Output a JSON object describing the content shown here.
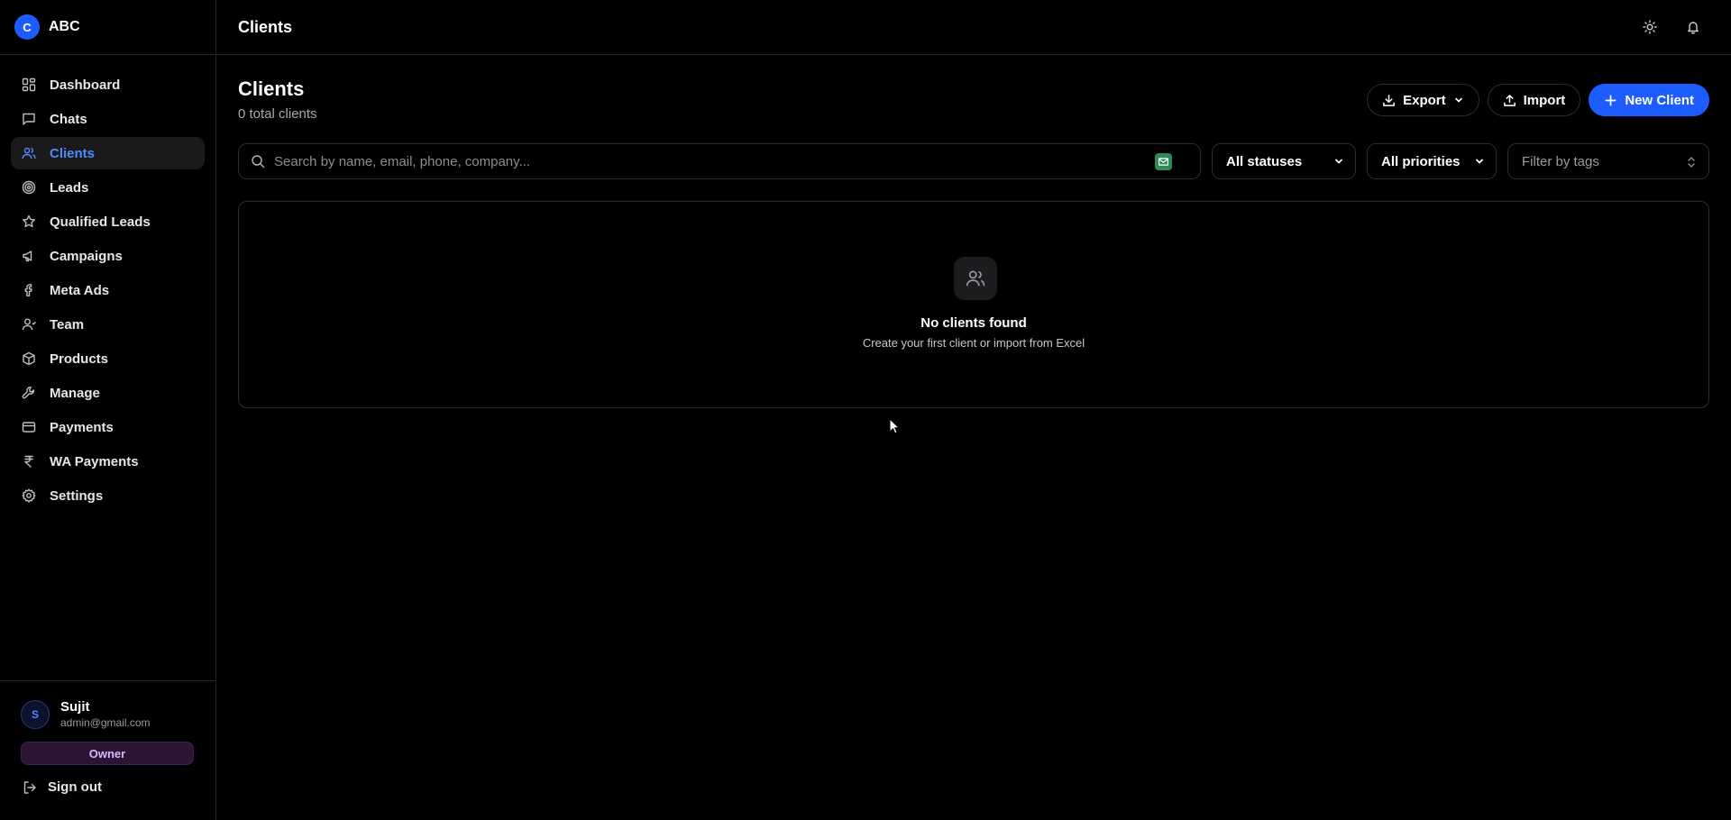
{
  "brand": {
    "logo_letter": "C",
    "name": "ABC"
  },
  "sidebar": {
    "items": [
      {
        "label": "Dashboard",
        "icon": "dashboard-icon",
        "active": false
      },
      {
        "label": "Chats",
        "icon": "chat-icon",
        "active": false
      },
      {
        "label": "Clients",
        "icon": "users-icon",
        "active": true
      },
      {
        "label": "Leads",
        "icon": "target-icon",
        "active": false
      },
      {
        "label": "Qualified Leads",
        "icon": "star-icon",
        "active": false
      },
      {
        "label": "Campaigns",
        "icon": "megaphone-icon",
        "active": false
      },
      {
        "label": "Meta Ads",
        "icon": "facebook-icon",
        "active": false
      },
      {
        "label": "Team",
        "icon": "user-icon",
        "active": false
      },
      {
        "label": "Products",
        "icon": "package-icon",
        "active": false
      },
      {
        "label": "Manage",
        "icon": "wrench-icon",
        "active": false
      },
      {
        "label": "Payments",
        "icon": "credit-card-icon",
        "active": false
      },
      {
        "label": "WA Payments",
        "icon": "rupee-icon",
        "active": false
      },
      {
        "label": "Settings",
        "icon": "gear-icon",
        "active": false
      }
    ]
  },
  "user": {
    "avatar_letter": "S",
    "name": "Sujit",
    "email": "admin@gmail.com",
    "role": "Owner"
  },
  "signout_label": "Sign out",
  "topbar": {
    "title": "Clients",
    "icons": [
      "sun-icon",
      "bell-icon"
    ]
  },
  "page": {
    "title": "Clients",
    "subtitle": "0 total clients"
  },
  "actions": {
    "export_label": "Export",
    "import_label": "Import",
    "new_label": "New Client"
  },
  "filters": {
    "search_placeholder": "Search by name, email, phone, company...",
    "status_value": "All statuses",
    "priority_value": "All priorities",
    "tags_placeholder": "Filter by tags"
  },
  "empty": {
    "title": "No clients found",
    "description": "Create your first client or import from Excel"
  },
  "colors": {
    "accent": "#1d5cff",
    "active_text": "#4f8aff",
    "role_badge": "#2a1535"
  }
}
